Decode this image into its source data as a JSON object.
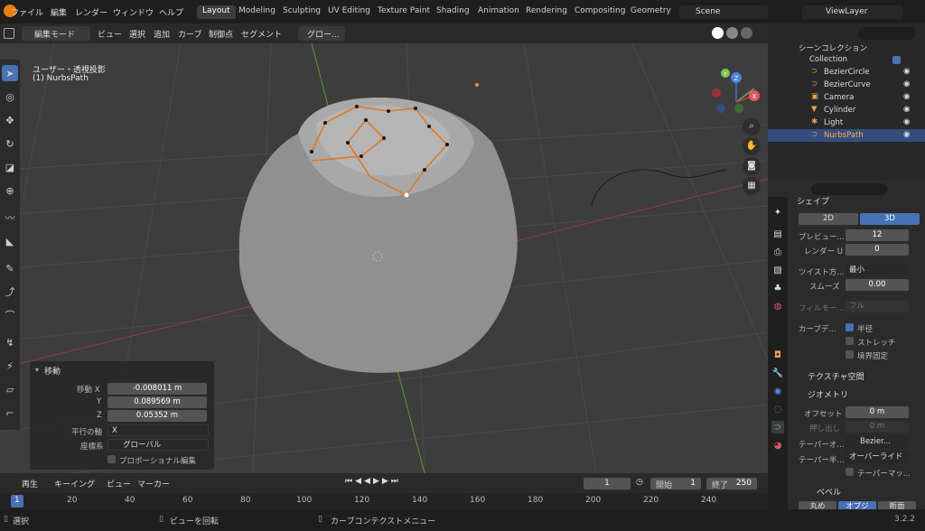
{
  "menu": {
    "file": "ファイル",
    "edit": "編集",
    "render": "レンダー",
    "window": "ウィンドウ",
    "help": "ヘルプ"
  },
  "workspaces": [
    "Layout",
    "Modeling",
    "Sculpting",
    "UV Editing",
    "Texture Paint",
    "Shading",
    "Animation",
    "Rendering",
    "Compositing",
    "Geometry"
  ],
  "scene": {
    "name": "Scene",
    "view_layer": "ViewLayer"
  },
  "viewport_header": {
    "mode": "編集モード",
    "view": "ビュー",
    "select": "選択",
    "add": "追加",
    "curve": "カーブ",
    "control_point": "制御点",
    "segment": "セグメント",
    "pivot": "グロー..."
  },
  "viewport": {
    "projection": "ユーザー・透視投影",
    "object": "(1) NurbsPath",
    "gizmo_x": "X",
    "gizmo_y": "Y",
    "gizmo_z": "Z"
  },
  "redo_panel": {
    "title": "移動",
    "move_x_label": "移動 X",
    "move_x": "-0.008011 m",
    "y_label": "Y",
    "y": "0.089569 m",
    "z_label": "Z",
    "z": "0.05352 m",
    "axis_label": "平行の軸",
    "axis": "X",
    "coord_label": "座標系",
    "coord": "グローバル",
    "proportional": "プロポーショナル編集"
  },
  "outliner": {
    "search_placeholder": "",
    "scene_collection": "シーンコレクション",
    "collection": "Collection",
    "items": [
      {
        "name": "BezierCircle",
        "color": "#e8a04a"
      },
      {
        "name": "BezierCurve",
        "color": "#e8a04a"
      },
      {
        "name": "Camera",
        "color": "#e8a04a"
      },
      {
        "name": "Cylinder",
        "color": "#e8a04a"
      },
      {
        "name": "Light",
        "color": "#e8a04a"
      },
      {
        "name": "NurbsPath",
        "color": "#e8a04a"
      }
    ]
  },
  "properties": {
    "shape_header": "シェイプ",
    "dim2": "2D",
    "dim3": "3D",
    "preview_label": "プレビュー...",
    "preview": "12",
    "render_u_label": "レンダー U",
    "render_u": "0",
    "twist_label": "ツイスト方...",
    "twist": "最小",
    "smooth_label": "スムーズ",
    "smooth": "0.00",
    "fill_label": "フィルモー...",
    "fill": "フル",
    "curve_def_label": "カーブデ...",
    "radius": "半径",
    "stretch": "ストレッチ",
    "bounds": "境界固定",
    "texspace": "テクスチャ空間",
    "geometry": "ジオメトリ",
    "offset_label": "オフセット",
    "offset": "0 m",
    "extrude_label": "押し出し",
    "extrude": "0 m",
    "taper_obj_label": "テーパーオ...",
    "taper_obj": "Bezier...",
    "taper_rad_label": "テーパー半...",
    "taper_rad": "オーバーライド",
    "taper_map": "テーパーマッ...",
    "bevel": "ベベル",
    "bevel_round": "丸め",
    "bevel_object": "オブジェ...",
    "bevel_profile": "断面"
  },
  "timeline": {
    "playback": "再生",
    "keying": "キーイング",
    "view": "ビュー",
    "marker": "マーカー",
    "current_frame": "1",
    "start_label": "開始",
    "start": "1",
    "end_label": "終了",
    "end": "250",
    "ticks": [
      "1",
      "20",
      "40",
      "60",
      "80",
      "100",
      "120",
      "140",
      "160",
      "180",
      "200",
      "220",
      "240"
    ]
  },
  "statusbar": {
    "select": "選択",
    "rotate": "ビューを回転",
    "context": "カーブコンテクストメニュー",
    "version": "3.2.2"
  }
}
